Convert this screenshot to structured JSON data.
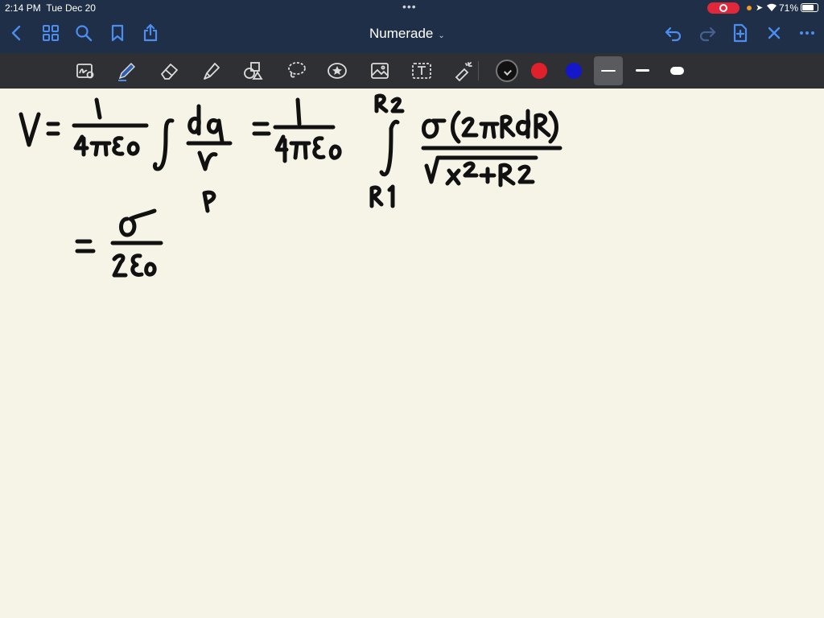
{
  "status_bar": {
    "time": "2:14 PM",
    "date": "Tue Dec 20",
    "battery": "71%",
    "battery_level": 0.71
  },
  "app": {
    "title": "Numerade"
  },
  "nav_icons": [
    "back-icon",
    "thumbnails-icon",
    "search-icon",
    "bookmark-icon",
    "share-icon",
    "undo-icon",
    "redo-icon",
    "add-page-icon",
    "close-icon",
    "more-icon"
  ],
  "tool_icons": [
    "zoom-write-icon",
    "pen-icon",
    "eraser-icon",
    "highlighter-icon",
    "shapes-icon",
    "lasso-icon",
    "sticker-icon",
    "image-icon",
    "text-icon",
    "laser-pointer-icon"
  ],
  "colors": {
    "nav_bar": "#1f2f47",
    "toolbar": "#2f3033",
    "paper": "#f5f4e6",
    "accent": "#4c8ef0",
    "ink_black": "#111111",
    "ink_red": "#e0202a",
    "ink_blue": "#1418c8"
  },
  "selected_color": "black",
  "stroke_sizes": [
    "thin",
    "medium",
    "thick"
  ],
  "selected_stroke": "thin"
}
